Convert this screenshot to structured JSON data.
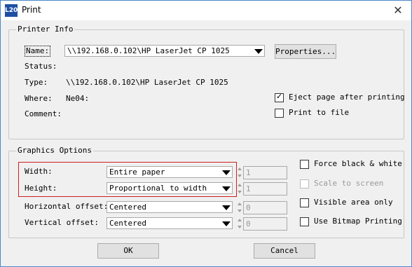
{
  "window": {
    "title": "Print",
    "app_icon": "L20",
    "close_glyph": "✕"
  },
  "printer_info": {
    "legend": "Printer Info",
    "name_label": "Name:",
    "name_value": "\\\\192.168.0.102\\HP LaserJet CP 1025",
    "properties_button": "Properties...",
    "status_label": "Status:",
    "status_value": "",
    "type_label": "Type:",
    "type_value": "\\\\192.168.0.102\\HP LaserJet CP 1025",
    "where_label": "Where:",
    "where_value": "Ne04:",
    "comment_label": "Comment:",
    "comment_value": "",
    "eject_label": "Eject page after printing",
    "eject_checked": true,
    "print_to_file_label": "Print to file",
    "print_to_file_checked": false
  },
  "graphics_options": {
    "legend": "Graphics Options",
    "width_label": "Width:",
    "width_value": "Entire paper",
    "width_number": "1",
    "height_label": "Height:",
    "height_value": "Proportional to width",
    "height_number": "1",
    "horizontal_offset_label": "Horizontal offset:",
    "horizontal_offset_value": "Centered",
    "horizontal_offset_number": "0",
    "vertical_offset_label": "Vertical offset:",
    "vertical_offset_value": "Centered",
    "vertical_offset_number": "0",
    "force_bw_label": "Force black & white",
    "scale_to_screen_label": "Scale to screen",
    "visible_area_only_label": "Visible area only",
    "use_bitmap_label": "Use Bitmap Printing"
  },
  "buttons": {
    "ok": "OK",
    "cancel": "Cancel"
  },
  "colors": {
    "highlight_border": "#cc2020",
    "title_icon": "#1e4fa3"
  }
}
